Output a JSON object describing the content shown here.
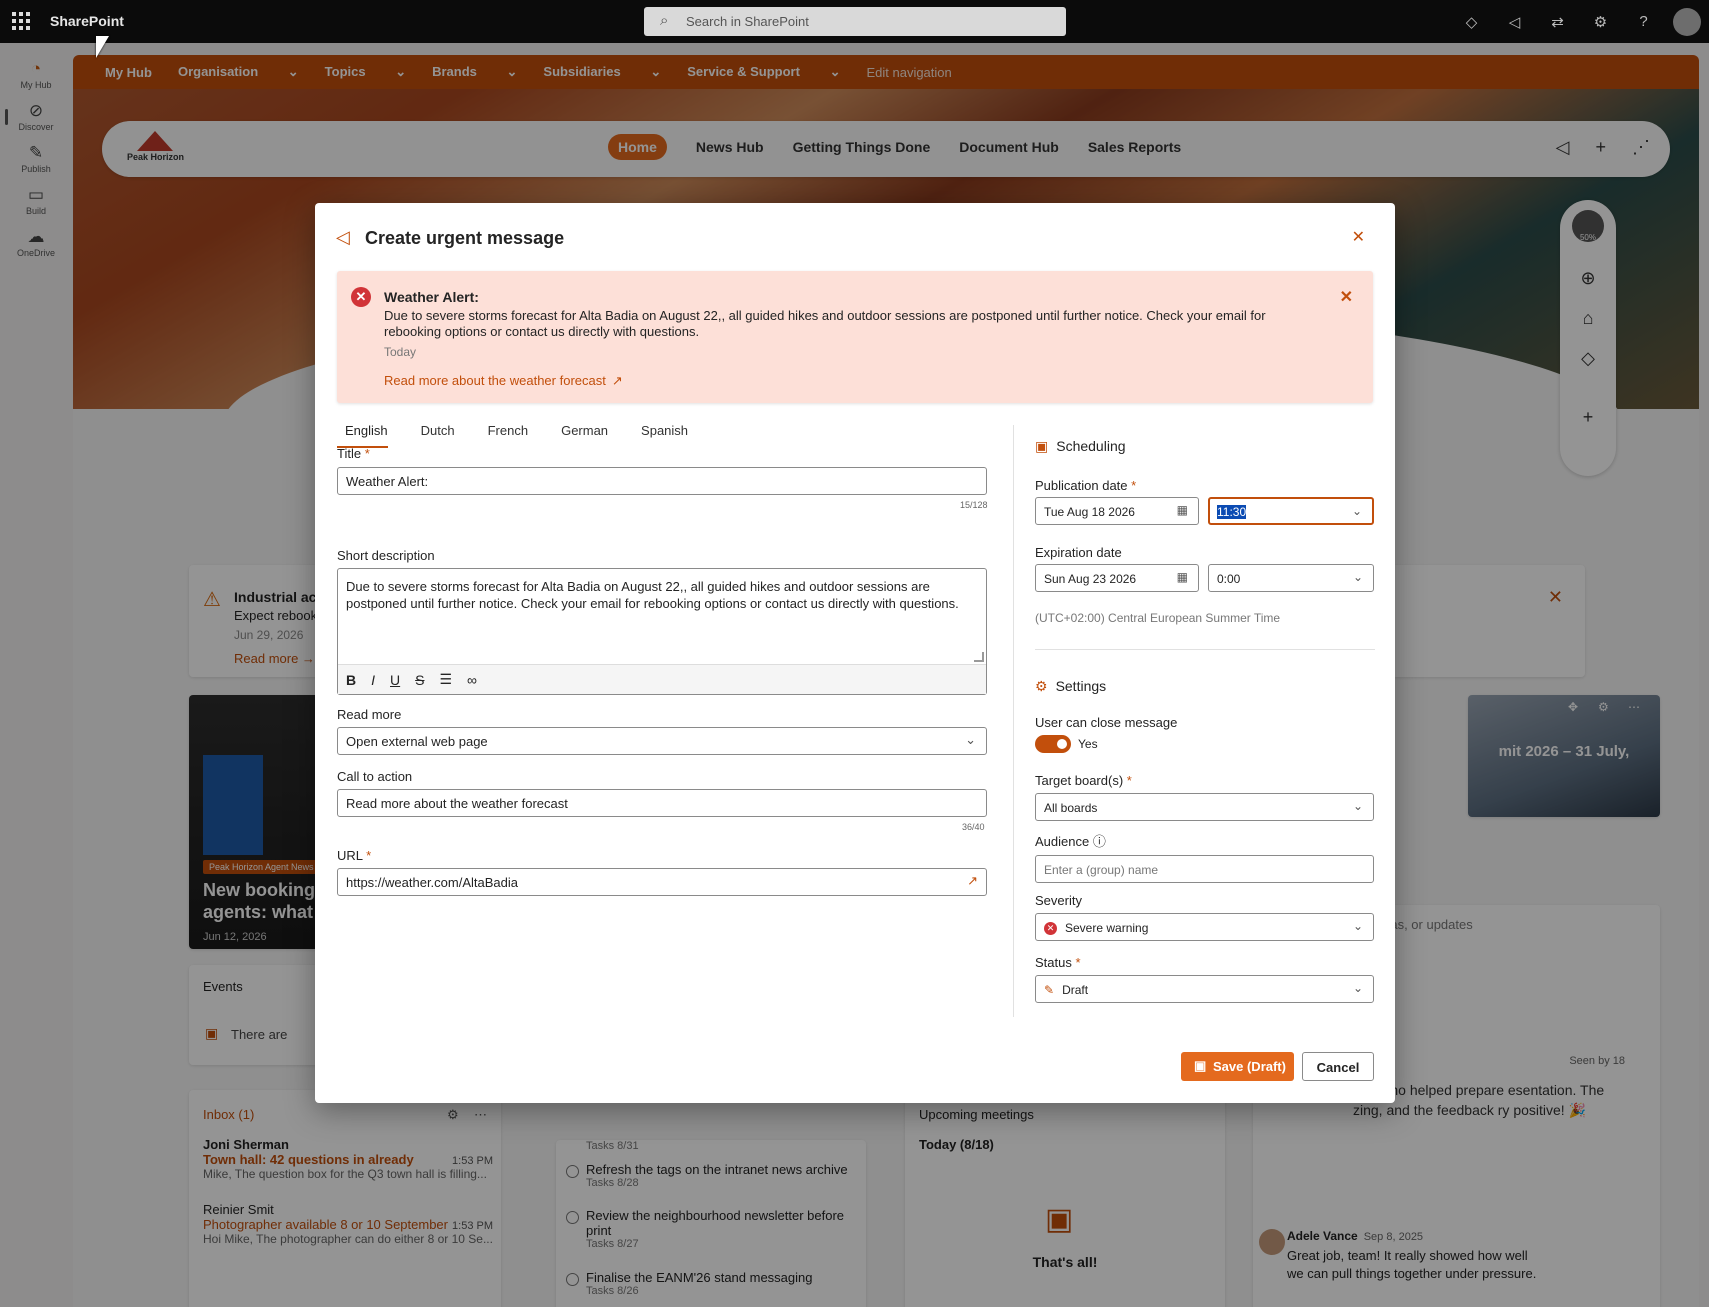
{
  "suite": {
    "brand": "SharePoint",
    "search_placeholder": "Search in SharePoint"
  },
  "rail": [
    {
      "label": "My Hub",
      "icon": "my-hub-icon"
    },
    {
      "label": "Discover",
      "icon": "discover-icon"
    },
    {
      "label": "Publish",
      "icon": "pencil-icon"
    },
    {
      "label": "Build",
      "icon": "build-icon"
    },
    {
      "label": "OneDrive",
      "icon": "cloud-icon"
    }
  ],
  "hubnav": {
    "items": [
      "My Hub",
      "Organisation",
      "Topics",
      "Brands",
      "Subsidiaries",
      "Service & Support"
    ],
    "edit": "Edit navigation"
  },
  "site": {
    "logo_text": "Peak Horizon",
    "nav": [
      "Home",
      "News Hub",
      "Getting Things Done",
      "Document Hub",
      "Sales Reports"
    ],
    "progress_label": "50%"
  },
  "background": {
    "alert": {
      "title": "Industrial ac",
      "desc": "Expect rebook",
      "date": "Jun 29, 2026",
      "read_more": "Read more →"
    },
    "news": {
      "tag": "Peak Horizon Agent News",
      "headline": "New booking agents: what c",
      "date": "Jun 12, 2026"
    },
    "carousel_headline": "mit 2026 – 31 July,",
    "events": {
      "title": "Events",
      "empty": "There are"
    },
    "inbox": {
      "title": "Inbox (1)",
      "mails": [
        {
          "from": "Joni Sherman",
          "subject": "Town hall: 42 questions in already",
          "preview": "Mike, The question box for the Q3 town hall is filling...",
          "time": "1:53 PM"
        },
        {
          "from": "Reinier Smit",
          "subject": "Photographer available 8 or 10 September",
          "preview": "Hoi Mike, The photographer can do either 8 or 10 Se...",
          "time": "1:53 PM"
        }
      ]
    },
    "tasks": [
      {
        "title": "",
        "meta": "Tasks  8/31"
      },
      {
        "title": "Refresh the tags on the intranet news archive",
        "meta": "Tasks  8/28"
      },
      {
        "title": "Review the neighbourhood newsletter before print",
        "meta": "Tasks  8/27"
      },
      {
        "title": "Finalise the EANM'26 stand messaging",
        "meta": "Tasks  8/26"
      }
    ],
    "meetings": {
      "title": "Upcoming meetings",
      "day": "Today (8/18)",
      "empty": "That's all!"
    },
    "feed": {
      "placeholder": "ideas, or updates",
      "seen": "Seen by 18",
      "post": "one who helped prepare esentation. The zing, and the feedback ry positive! 🎉",
      "reply_name": "Adele Vance",
      "reply_date": "Sep 8, 2025",
      "reply_body": "Great job, team! It really showed how well we can pull things together under pressure."
    }
  },
  "dialog": {
    "title": "Create urgent message",
    "preview": {
      "title": "Weather Alert:",
      "desc": "Due to severe storms forecast for Alta Badia on August 22,, all guided hikes and outdoor sessions are postponed until further notice. Check your email for rebooking options or contact us directly with questions.",
      "date": "Today",
      "link": "Read more about the weather forecast"
    },
    "tabs": [
      "English",
      "Dutch",
      "French",
      "German",
      "Spanish"
    ],
    "fields": {
      "title_label": "Title",
      "title_value": "Weather Alert:",
      "title_count": "15/128",
      "short_desc_label": "Short description",
      "short_desc_value": "Due to severe storms forecast for Alta Badia on August 22,, all guided hikes and outdoor sessions are postponed until further notice. Check your email for rebooking options or contact us directly with questions.",
      "read_more_label": "Read more",
      "read_more_value": "Open external web page",
      "cta_label": "Call to action",
      "cta_value": "Read more about the weather forecast",
      "cta_count": "36/40",
      "url_label": "URL",
      "url_value": "https://weather.com/AltaBadia"
    },
    "scheduling": {
      "title": "Scheduling",
      "pub_label": "Publication date",
      "pub_date": "Tue Aug 18 2026",
      "pub_time": "11:30",
      "exp_label": "Expiration date",
      "exp_date": "Sun Aug 23 2026",
      "exp_time": "0:00",
      "timezone": "(UTC+02:00) Central European Summer Time"
    },
    "settings": {
      "title": "Settings",
      "close_label": "User can close message",
      "close_value": "Yes",
      "boards_label": "Target board(s)",
      "boards_value": "All boards",
      "audience_label": "Audience",
      "audience_placeholder": "Enter a (group) name",
      "severity_label": "Severity",
      "severity_value": "Severe warning",
      "status_label": "Status",
      "status_value": "Draft"
    },
    "buttons": {
      "save": "Save (Draft)",
      "cancel": "Cancel"
    }
  },
  "colors": {
    "accent": "#c24f0c",
    "button": "#e46a1e",
    "alert_bg": "#fde0d8",
    "error": "#d13438"
  }
}
